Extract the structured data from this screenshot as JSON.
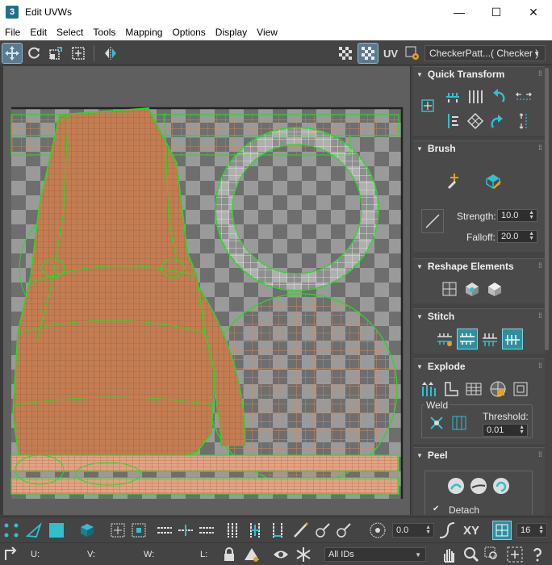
{
  "window": {
    "app_icon": "3",
    "title": "Edit UVWs",
    "minimize": "—",
    "maximize": "☐",
    "close": "✕"
  },
  "menu": [
    "File",
    "Edit",
    "Select",
    "Tools",
    "Mapping",
    "Options",
    "Display",
    "View"
  ],
  "toolbar": {
    "uv_label": "UV",
    "checker_dropdown": "CheckerPatt...( Checker )"
  },
  "panel": {
    "quick_transform": {
      "title": "Quick Transform"
    },
    "brush": {
      "title": "Brush",
      "strength_label": "Strength:",
      "strength_value": "10.0",
      "falloff_label": "Falloff:",
      "falloff_value": "20.0"
    },
    "reshape": {
      "title": "Reshape Elements"
    },
    "stitch": {
      "title": "Stitch"
    },
    "explode": {
      "title": "Explode",
      "weld_label": "Weld",
      "threshold_label": "Threshold:",
      "threshold_value": "0.01"
    },
    "peel": {
      "title": "Peel",
      "detach_label": "Detach",
      "detach_checked": true
    }
  },
  "bottom": {
    "angle_value": "0.0",
    "xy_label": "XY",
    "pixel_value": "16",
    "u_label": "U:",
    "v_label": "V:",
    "w_label": "W:",
    "l_label": "L:",
    "ids_value": "All IDs"
  },
  "colors": {
    "accent": "#2f8f9d",
    "uv_green": "#22dd22",
    "uv_orange": "#d88a5a"
  }
}
